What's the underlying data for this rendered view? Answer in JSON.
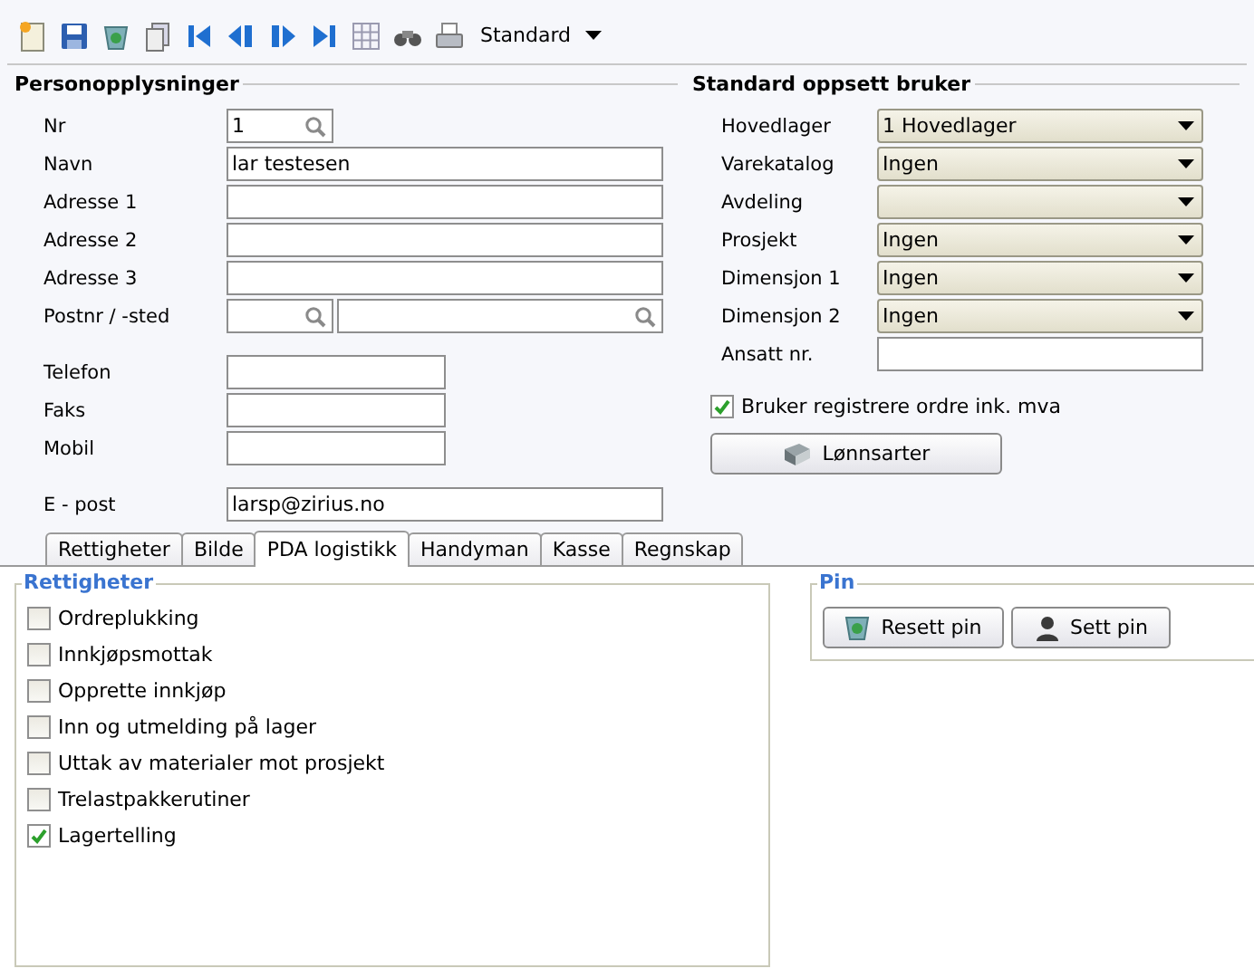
{
  "toolbar": {
    "tools": [
      {
        "kind": "new"
      },
      {
        "kind": "save"
      },
      {
        "kind": "recycle"
      },
      {
        "kind": "copy"
      },
      {
        "kind": "first"
      },
      {
        "kind": "prev"
      },
      {
        "kind": "next"
      },
      {
        "kind": "last"
      },
      {
        "kind": "grid"
      },
      {
        "kind": "search"
      },
      {
        "kind": "print"
      }
    ],
    "layout": "Standard"
  },
  "person": {
    "title": "Personopplysninger",
    "groups": [
      [
        {
          "label": "Nr",
          "kind": "lookup",
          "value": "1"
        },
        {
          "label": "Navn",
          "kind": "text",
          "value": "lar testesen"
        },
        {
          "label": "Adresse 1",
          "kind": "text"
        },
        {
          "label": "Adresse 2",
          "kind": "text"
        },
        {
          "label": "Adresse 3",
          "kind": "text"
        },
        {
          "label": "Postnr / -sted",
          "kind": "postal"
        }
      ],
      [
        {
          "label": "Telefon",
          "kind": "short"
        },
        {
          "label": "Faks",
          "kind": "short"
        },
        {
          "label": "Mobil",
          "kind": "short"
        }
      ],
      [
        {
          "label": "E - post",
          "kind": "text",
          "value": "larsp@zirius.no"
        }
      ]
    ]
  },
  "settings": {
    "title": "Standard oppsett bruker",
    "fields": [
      {
        "label": "Hovedlager",
        "kind": "combo",
        "value": "1 Hovedlager"
      },
      {
        "label": "Varekatalog",
        "kind": "combo",
        "value": "Ingen"
      },
      {
        "label": "Avdeling",
        "kind": "combo"
      },
      {
        "label": "Prosjekt",
        "kind": "combo",
        "value": "Ingen"
      },
      {
        "label": "Dimensjon 1",
        "kind": "combo",
        "value": "Ingen"
      },
      {
        "label": "Dimensjon 2",
        "kind": "combo",
        "value": "Ingen"
      },
      {
        "label": "Ansatt nr.",
        "kind": "text"
      }
    ],
    "option": {
      "label": "Bruker registrere ordre ink. mva",
      "checked": true
    },
    "button": "Lønnsarter"
  },
  "tabs": [
    {
      "label": "Rettigheter",
      "selected": false
    },
    {
      "label": "Bilde",
      "selected": false
    },
    {
      "label": "PDA logistikk",
      "selected": true
    },
    {
      "label": "Handyman",
      "selected": false
    },
    {
      "label": "Kasse",
      "selected": false
    },
    {
      "label": "Regnskap",
      "selected": false
    }
  ],
  "rights": {
    "title": "Rettigheter",
    "items": [
      {
        "label": "Ordreplukking",
        "checked": false
      },
      {
        "label": "Innkjøpsmottak",
        "checked": false
      },
      {
        "label": "Opprette innkjøp",
        "checked": false
      },
      {
        "label": "Inn og utmelding på lager",
        "checked": false
      },
      {
        "label": "Uttak av materialer mot prosjekt",
        "checked": false
      },
      {
        "label": "Trelastpakkerutiner",
        "checked": false
      },
      {
        "label": "Lagertelling",
        "checked": true
      }
    ]
  },
  "pin": {
    "title": "Pin",
    "buttons": [
      {
        "kind": "reset",
        "label": "Resett pin"
      },
      {
        "kind": "set",
        "label": "Sett pin"
      }
    ]
  }
}
